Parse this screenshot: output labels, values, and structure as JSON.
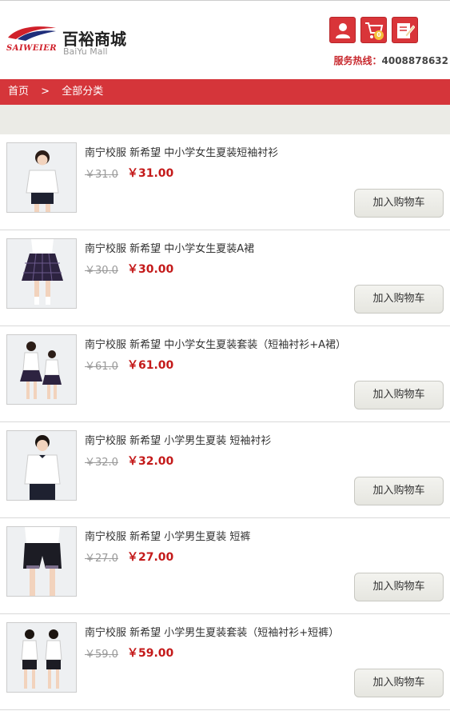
{
  "header": {
    "logo_en": "SAIWEIER",
    "logo_cn": "百裕商城",
    "logo_sub": "BaiYu Mall",
    "cart_count": "0",
    "hotline_label": "服务热线：",
    "hotline_number": "4008878632",
    "icons": [
      "user-icon",
      "cart-icon",
      "edit-icon"
    ]
  },
  "breadcrumb": {
    "home": "首页",
    "separator": ">",
    "current": "全部分类"
  },
  "products": [
    {
      "title": "南宁校服 新希望 中小学女生夏装短袖衬衫",
      "old_price": "￥31.0",
      "price": "￥31.00",
      "button": "加入购物车"
    },
    {
      "title": "南宁校服 新希望 中小学女生夏装A裙",
      "old_price": "￥30.0",
      "price": "￥30.00",
      "button": "加入购物车"
    },
    {
      "title": "南宁校服 新希望 中小学女生夏装套装（短袖衬衫+A裙）",
      "old_price": "￥61.0",
      "price": "￥61.00",
      "button": "加入购物车"
    },
    {
      "title": "南宁校服 新希望 小学男生夏装 短袖衬衫",
      "old_price": "￥32.0",
      "price": "￥32.00",
      "button": "加入购物车"
    },
    {
      "title": "南宁校服 新希望 小学男生夏装 短裤",
      "old_price": "￥27.0",
      "price": "￥27.00",
      "button": "加入购物车"
    },
    {
      "title": "南宁校服 新希望 小学男生夏装套装（短袖衬衫+短裤）",
      "old_price": "￥59.0",
      "price": "￥59.00",
      "button": "加入购物车"
    }
  ],
  "colors": {
    "brand_red": "#d5353a",
    "price_red": "#c41a1a",
    "bg_grey": "#ebebe6"
  }
}
